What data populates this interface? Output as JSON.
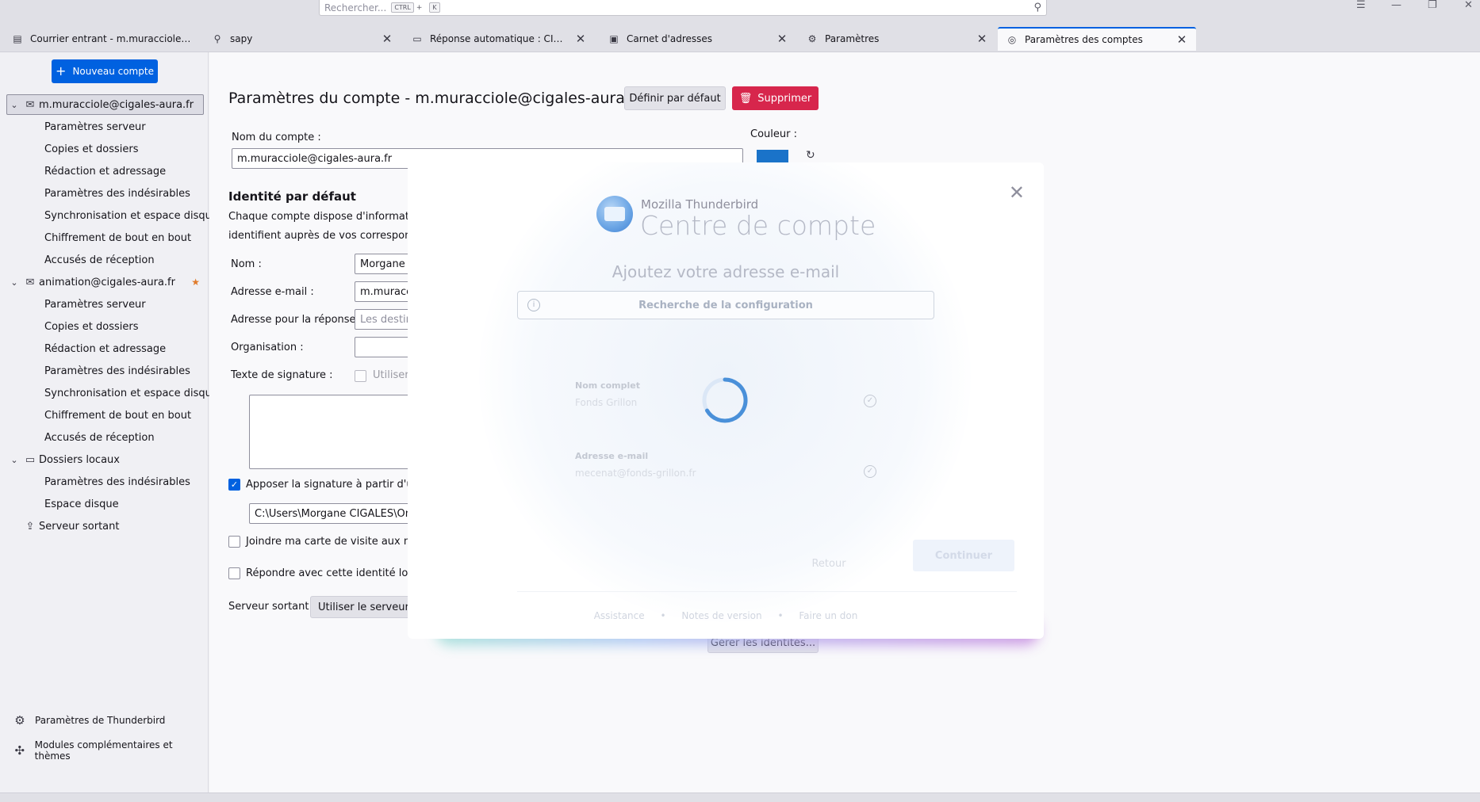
{
  "titlebar": {
    "search_placeholder": "Rechercher...",
    "shortcut_ctrl": "CTRL",
    "shortcut_plus": "+",
    "shortcut_key": "K",
    "search_icon": "magnifier-icon",
    "menu_glyph": "☰",
    "minimize_glyph": "—",
    "restore_glyph": "❐",
    "close_glyph": "✕"
  },
  "tabs": [
    {
      "label": "Courrier entrant - m.muracciole@cigale",
      "icon": "inbox-icon",
      "glyph": "▤",
      "closable": false
    },
    {
      "label": "sapy",
      "icon": "search-icon",
      "glyph": "⚲",
      "closable": true
    },
    {
      "label": "Réponse automatique : CIGALES IN",
      "icon": "folder-icon",
      "glyph": "▭",
      "closable": true
    },
    {
      "label": "Carnet d'adresses",
      "icon": "address-book-icon",
      "glyph": "▣",
      "closable": true
    },
    {
      "label": "Paramètres",
      "icon": "gear-icon",
      "glyph": "⚙",
      "closable": true
    },
    {
      "label": "Paramètres des comptes",
      "icon": "account-settings-icon",
      "glyph": "◎",
      "closable": true
    }
  ],
  "tab_close_glyph": "✕",
  "sidebar": {
    "new_account_label": "Nouveau compte",
    "accounts": [
      {
        "name": "m.muracciole@cigales-aura.fr",
        "selected": true,
        "starred": false,
        "children": [
          "Paramètres serveur",
          "Copies et dossiers",
          "Rédaction et adressage",
          "Paramètres des indésirables",
          "Synchronisation et espace disque",
          "Chiffrement de bout en bout",
          "Accusés de réception"
        ]
      },
      {
        "name": "animation@cigales-aura.fr",
        "selected": false,
        "starred": true,
        "children": [
          "Paramètres serveur",
          "Copies et dossiers",
          "Rédaction et adressage",
          "Paramètres des indésirables",
          "Synchronisation et espace disque",
          "Chiffrement de bout en bout",
          "Accusés de réception"
        ]
      },
      {
        "name": "Dossiers locaux",
        "selected": false,
        "starred": false,
        "children": [
          "Paramètres des indésirables",
          "Espace disque"
        ]
      }
    ],
    "outgoing_server": "Serveur sortant",
    "footer": {
      "thunderbird_settings": "Paramètres de Thunderbird",
      "addons": "Modules complémentaires et thèmes"
    }
  },
  "main": {
    "title": "Paramètres du compte - m.muracciole@cigales-aura.fr",
    "set_default_label": "Définir par défaut",
    "delete_label": "Supprimer",
    "account_name_label": "Nom du compte :",
    "account_name_value": "m.muracciole@cigales-aura.fr",
    "color_label": "Couleur :",
    "color_value": "#1a73c9",
    "identity_heading": "Identité par défaut",
    "identity_text_1": "Chaque compte dispose d'informations",
    "identity_text_2": "identifient auprès de vos correspondan",
    "name_label": "Nom :",
    "name_value": "Morgane N",
    "email_label": "Adresse e-mail :",
    "email_value": "m.muracci",
    "reply_label": "Adresse pour la réponse :",
    "reply_placeholder": "Les destina",
    "org_label": "Organisation :",
    "org_value": "",
    "signature_label": "Texte de signature :",
    "signature_html_label": "Utiliser",
    "attach_sig_label": "Apposer la signature à partir d'un f",
    "attach_sig_checked": true,
    "sig_path": "C:\\Users\\Morgane CIGALES\\OneD",
    "vcard_label": "Joindre ma carte de visite aux mess",
    "vcard_checked": false,
    "reply_identity_label": "Répondre avec cette identité lorsqu",
    "reply_identity_checked": false,
    "outgoing_label": "Serveur sortant :",
    "outgoing_value": "Utiliser le serveur pa",
    "manage_identities": "Gérer les identités..."
  },
  "modal": {
    "brand_small": "Mozilla Thunderbird",
    "brand_big": "Centre de compte",
    "subtitle": "Ajoutez votre adresse e-mail",
    "config_status": "Recherche de la configuration",
    "fullname_label": "Nom complet",
    "fullname_value": "Fonds Grillon",
    "email_label": "Adresse e-mail",
    "email_value": "mecenat@fonds-grillon.fr",
    "back_label": "Retour",
    "continue_label": "Continuer",
    "links": [
      "Assistance",
      "Notes de version",
      "Faire un don"
    ],
    "link_separator": "•",
    "close_glyph": "✕",
    "ok_glyph": "✓",
    "info_glyph": "i"
  },
  "colors": {
    "accent": "#0061e0",
    "danger": "#d7264c",
    "spinner": "#4a90d9"
  }
}
